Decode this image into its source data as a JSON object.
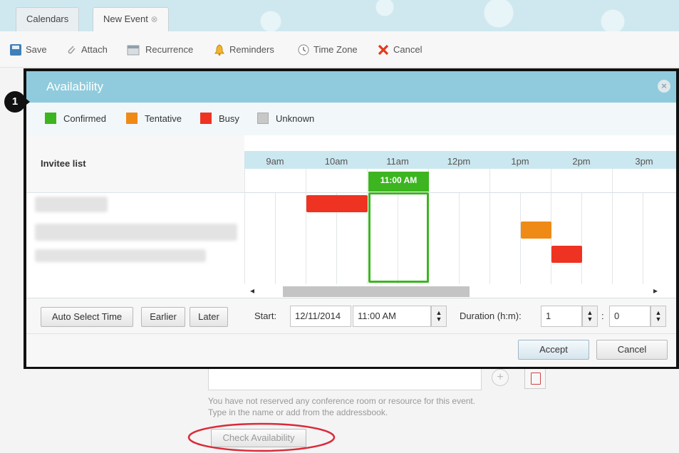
{
  "tabs": {
    "calendars": "Calendars",
    "new_event": "New Event",
    "close_glyph": "⊗"
  },
  "toolbar": {
    "save": "Save",
    "attach": "Attach",
    "recurrence": "Recurrence",
    "reminders": "Reminders",
    "time_zone": "Time Zone",
    "cancel": "Cancel"
  },
  "dialog": {
    "title": "Availability",
    "callout_number": "1",
    "legend": [
      {
        "label": "Confirmed",
        "color": "#3cb521"
      },
      {
        "label": "Tentative",
        "color": "#f08a17"
      },
      {
        "label": "Busy",
        "color": "#ee3322"
      },
      {
        "label": "Unknown",
        "color": "#c8c8c8"
      }
    ],
    "invitee_header": "Invitee list",
    "hours": [
      "9am",
      "10am",
      "11am",
      "12pm",
      "1pm",
      "2pm",
      "3pm"
    ],
    "selected_time_label": "11:00 AM",
    "scroll_left": "◂",
    "scroll_right": "▸",
    "auto_select": "Auto Select Time",
    "earlier": "Earlier",
    "later": "Later",
    "start_label": "Start:",
    "start_date": "12/11/2014",
    "start_time": "11:00 AM",
    "duration_label": "Duration (h:m):",
    "duration_hours": "1",
    "duration_sep": ":",
    "duration_minutes": "0",
    "accept": "Accept",
    "cancel": "Cancel"
  },
  "below": {
    "note_line1": "You have not reserved any conference room or resource for this event.",
    "note_line2": "Type in the name or add from the addressbook.",
    "check_availability": "Check Availability"
  },
  "colors": {
    "selection": "#3cb521",
    "busy": "#ee3322",
    "tentative": "#f08a17",
    "accent_header": "#8fcbdc"
  }
}
